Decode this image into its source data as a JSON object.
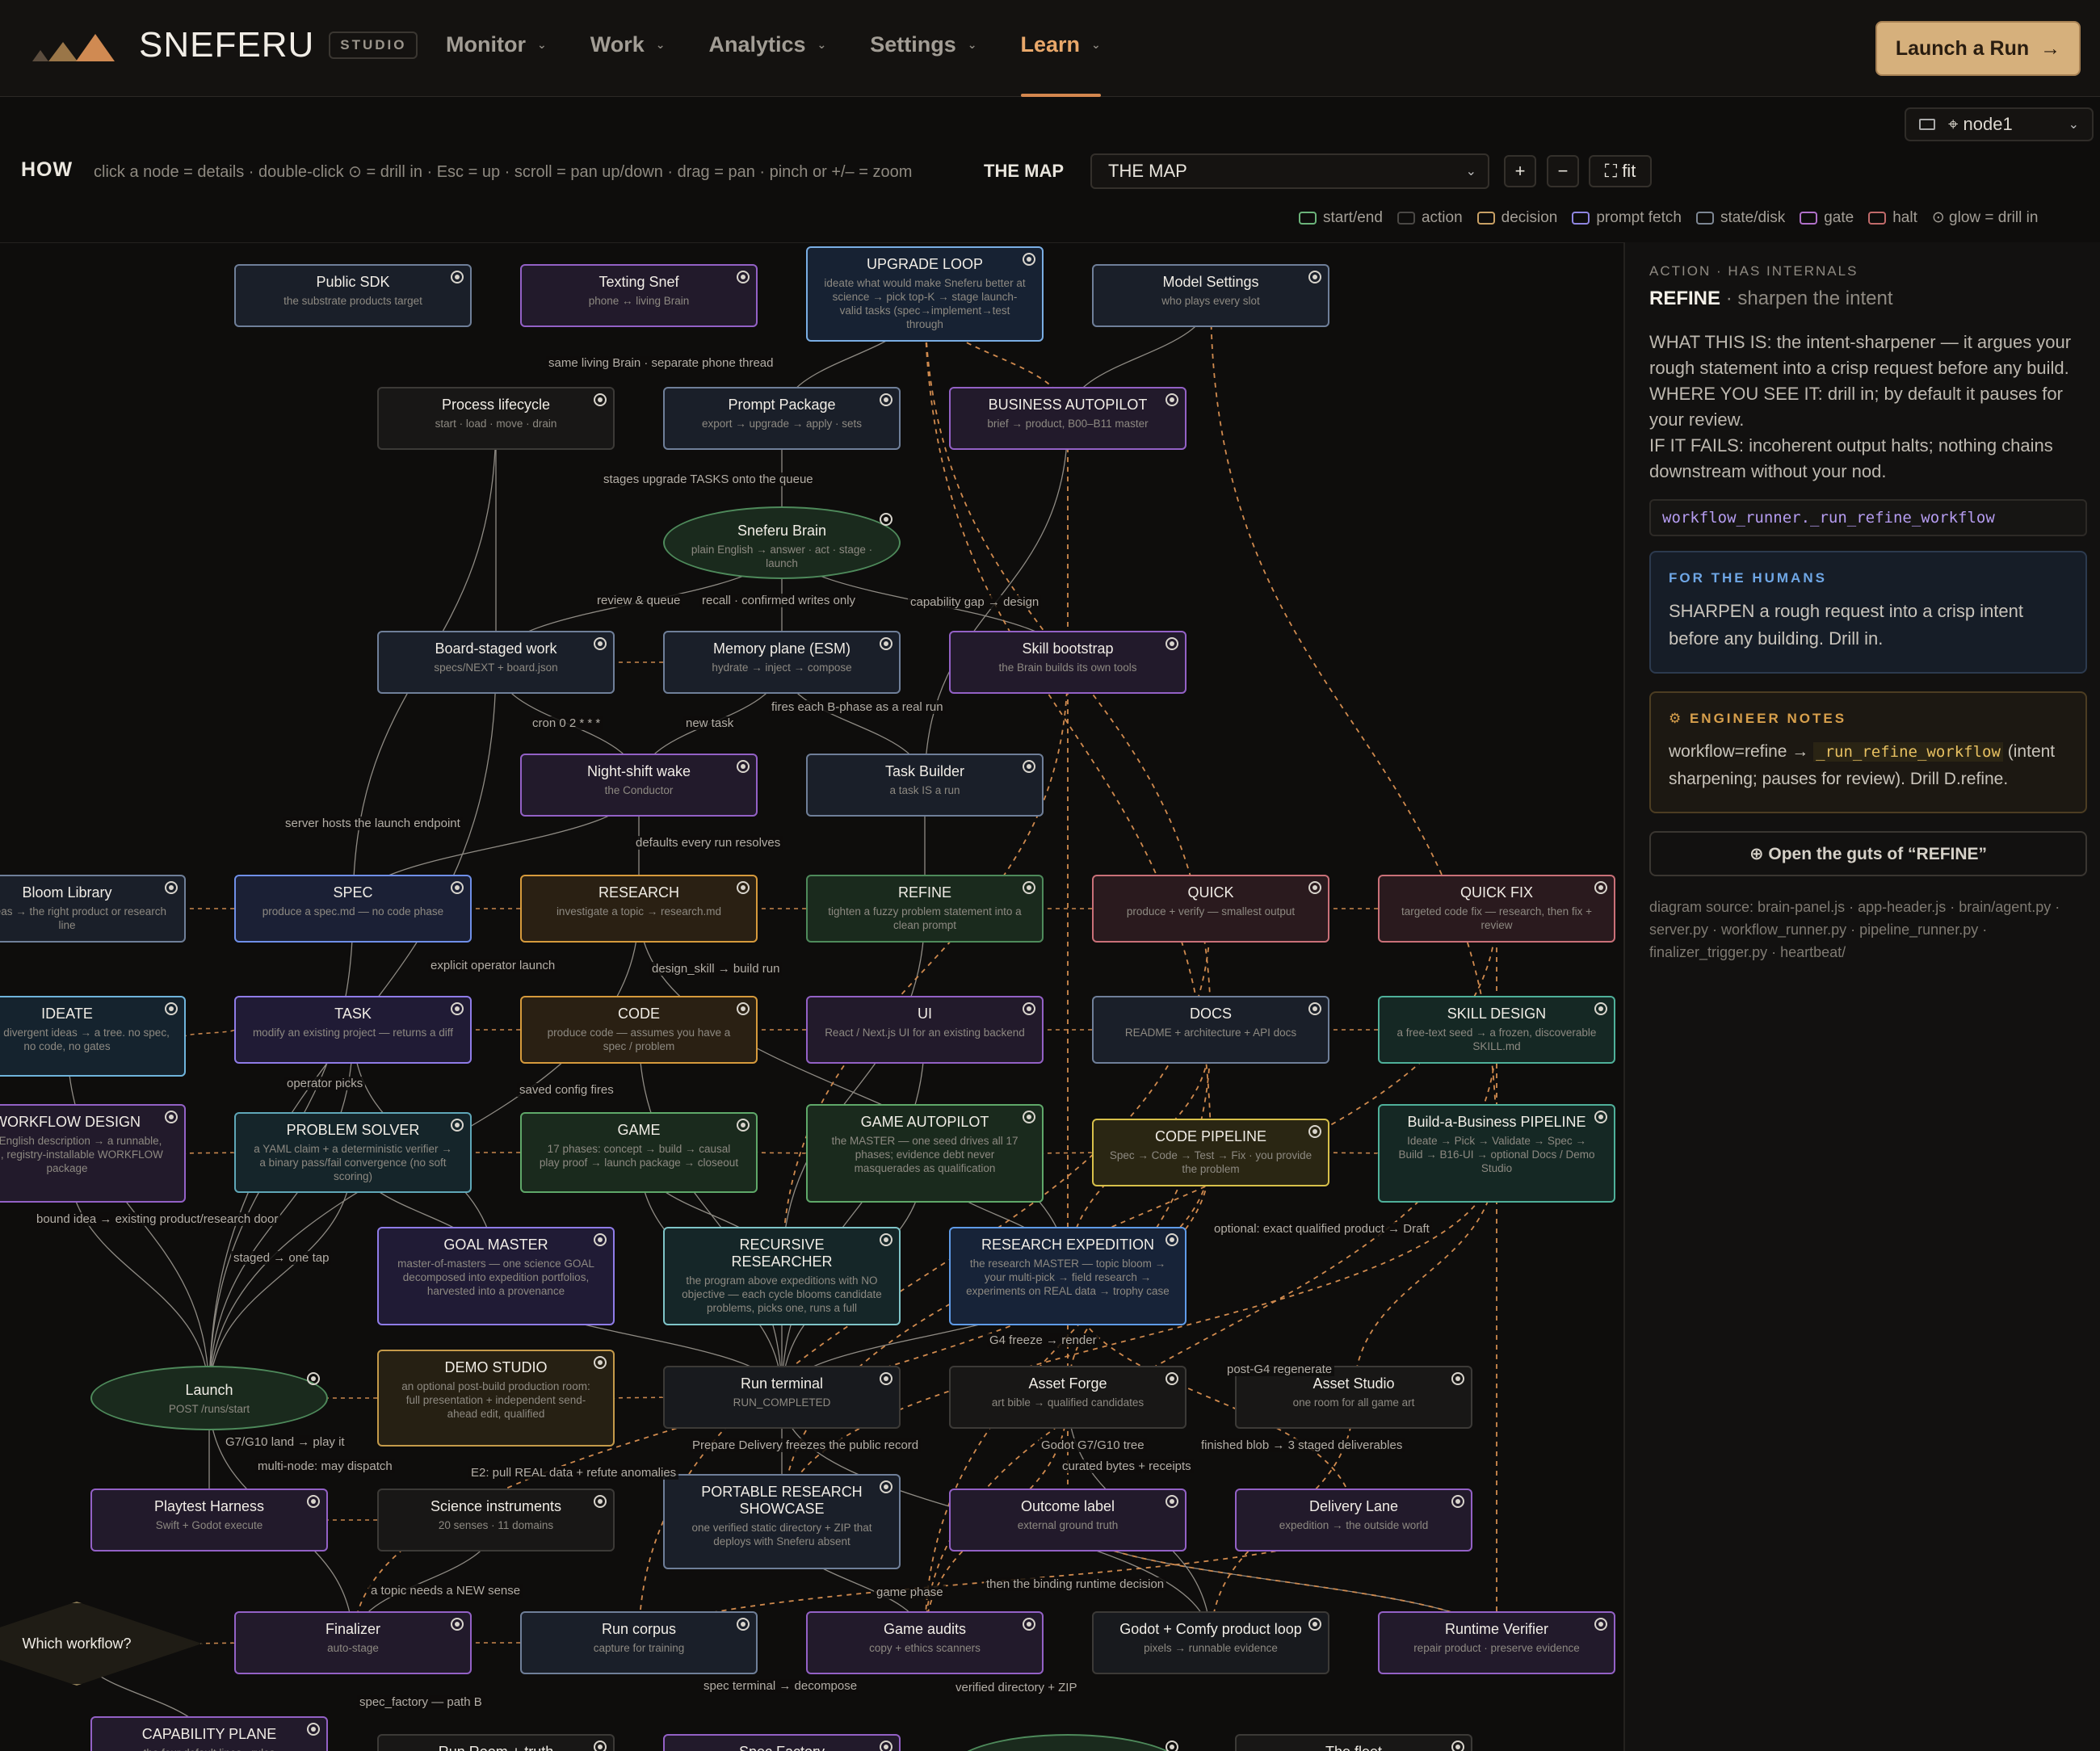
{
  "header": {
    "brand": "SNEFERU",
    "badge": "STUDIO",
    "nav": [
      {
        "label": "Monitor",
        "active": false
      },
      {
        "label": "Work",
        "active": false
      },
      {
        "label": "Analytics",
        "active": false
      },
      {
        "label": "Settings",
        "active": false
      },
      {
        "label": "Learn",
        "active": true
      }
    ],
    "launch_label": "Launch a Run",
    "launch_icon": "arrow-right-icon"
  },
  "toolbar": {
    "node_label": "⌖ node1",
    "how_title": "HOW",
    "how_text": "click a node = details · double-click ⊙ = drill in · Esc = up · scroll = pan up/down · drag = pan · pinch or +/– = zoom",
    "map_label": "THE MAP",
    "map_value": "THE MAP",
    "zoom_in": "+",
    "zoom_out": "−",
    "fit_label": "⛶ fit"
  },
  "legend": [
    {
      "label": "start/end",
      "color": "#6bb37a"
    },
    {
      "label": "action",
      "color": "#4a4845"
    },
    {
      "label": "decision",
      "color": "#c8a064"
    },
    {
      "label": "prompt fetch",
      "color": "#8f85e0"
    },
    {
      "label": "state/disk",
      "color": "#7d8794"
    },
    {
      "label": "gate",
      "color": "#b070c8"
    },
    {
      "label": "halt",
      "color": "#c06a6a"
    },
    {
      "label": "⊙ glow = drill in",
      "color": ""
    }
  ],
  "graph": {
    "nodes": [
      {
        "title": "Public SDK",
        "sub": "the substrate products target",
        "color": "#6f7f99",
        "fill": "#1a1f29"
      },
      {
        "title": "Texting Snef",
        "sub": "phone ↔ living Brain",
        "color": "#9361c6",
        "fill": "#221a2b"
      },
      {
        "title": "UPGRADE LOOP",
        "sub": "ideate what would make Sneferu better at science → pick top-K → stage launch-valid tasks (spec→implement→test through",
        "color": "#7aaee4",
        "fill": "#172233"
      },
      {
        "title": "Model Settings",
        "sub": "who plays every slot",
        "color": "#6f7f99",
        "fill": "#1a1f29"
      },
      {
        "title": "Process lifecycle",
        "sub": "start · load · move · drain",
        "color": "#3c3a37",
        "fill": "#181716"
      },
      {
        "title": "Prompt Package",
        "sub": "export → upgrade → apply · sets",
        "color": "#6f7f99",
        "fill": "#1a1f29"
      },
      {
        "title": "BUSINESS AUTOPILOT",
        "sub": "brief → product, B00–B11 master",
        "color": "#9361c6",
        "fill": "#221a2b"
      },
      {
        "title": "Sneferu Brain",
        "sub": "plain English → answer · act · stage · launch",
        "color": "#4e8a5b",
        "fill": "#1a2a1d"
      },
      {
        "title": "Board-staged work",
        "sub": "specs/NEXT + board.json",
        "color": "#6f7f99",
        "fill": "#1a1f29"
      },
      {
        "title": "Memory plane (ESM)",
        "sub": "hydrate → inject → compose",
        "color": "#6f7f99",
        "fill": "#1a1f29"
      },
      {
        "title": "Skill bootstrap",
        "sub": "the Brain builds its own tools",
        "color": "#9361c6",
        "fill": "#221a2b"
      },
      {
        "title": "Night-shift wake",
        "sub": "the Conductor",
        "color": "#9361c6",
        "fill": "#221a2b"
      },
      {
        "title": "Task Builder",
        "sub": "a task IS a run",
        "color": "#6f7f99",
        "fill": "#1a1f29"
      },
      {
        "title": "Bloom Library",
        "sub": "red ideas → the right product or research line",
        "color": "#6f7f99",
        "fill": "#1a1f29"
      },
      {
        "title": "SPEC",
        "sub": "produce a spec.md — no code phase",
        "color": "#6f8fe8",
        "fill": "#1b2035"
      },
      {
        "title": "RESEARCH",
        "sub": "investigate a topic → research.md",
        "color": "#d69a3c",
        "fill": "#2a2013"
      },
      {
        "title": "REFINE",
        "sub": "tighten a fuzzy problem statement into a clean prompt",
        "color": "#4e8a5b",
        "fill": "#1a2a1d"
      },
      {
        "title": "QUICK",
        "sub": "produce + verify — smallest output",
        "color": "#c97078",
        "fill": "#2a1a1e"
      },
      {
        "title": "QUICK FIX",
        "sub": "targeted code fix — research, then fix + review",
        "color": "#c97078",
        "fill": "#2a1a1e"
      },
      {
        "title": "IDEATE",
        "sub": "explore divergent ideas → a tree. no spec, no code, no gates",
        "color": "#6fb4dc",
        "fill": "#15232e"
      },
      {
        "title": "TASK",
        "sub": "modify an existing project — returns a diff",
        "color": "#8f7ce8",
        "fill": "#201b35"
      },
      {
        "title": "CODE",
        "sub": "produce code — assumes you have a spec / problem",
        "color": "#d69a3c",
        "fill": "#2a2013"
      },
      {
        "title": "UI",
        "sub": "React / Next.js UI for an existing backend",
        "color": "#9361c6",
        "fill": "#221a2b"
      },
      {
        "title": "DOCS",
        "sub": "README + architecture + API docs",
        "color": "#6f7f99",
        "fill": "#1a1f29"
      },
      {
        "title": "SKILL DESIGN",
        "sub": "a free-text seed → a frozen, discoverable SKILL.md",
        "color": "#4fb09a",
        "fill": "#152824"
      },
      {
        "title": "WORKFLOW DESIGN",
        "sub": "plain-English description → a runnable, tested, registry-installable WORKFLOW package",
        "color": "#9361c6",
        "fill": "#221a2b"
      },
      {
        "title": "PROBLEM SOLVER",
        "sub": "a YAML claim + a deterministic verifier → a binary pass/fail convergence (no soft scoring)",
        "color": "#5fa7b8",
        "fill": "#15252a"
      },
      {
        "title": "GAME",
        "sub": "17 phases: concept → build → causal play proof → launch package → closeout",
        "color": "#5fa869",
        "fill": "#1a2a1d"
      },
      {
        "title": "GAME AUTOPILOT",
        "sub": "the MASTER — one seed drives all 17 phases; evidence debt never masquerades as qualification",
        "color": "#5fa869",
        "fill": "#1a2a1d"
      },
      {
        "title": "CODE PIPELINE",
        "sub": "Spec → Code → Test → Fix · you provide the problem",
        "color": "#d7c04a",
        "fill": "#2a2613"
      },
      {
        "title": "Build-a-Business PIPELINE",
        "sub": "Ideate → Pick → Validate → Spec → Build → B16-UI → optional Docs / Demo Studio",
        "color": "#4fb09a",
        "fill": "#152824"
      },
      {
        "title": "GOAL MASTER",
        "sub": "master-of-masters — one science GOAL decomposed into expedition portfolios, harvested into a provenance",
        "color": "#8f7ce8",
        "fill": "#201b35"
      },
      {
        "title": "RECURSIVE RESEARCHER",
        "sub": "the program above expeditions with NO objective — each cycle blooms candidate problems, picks one, runs a full",
        "color": "#7fc4c8",
        "fill": "#152628"
      },
      {
        "title": "RESEARCH EXPEDITION",
        "sub": "the research MASTER — topic bloom → your multi-pick → field research → experiments on REAL data → trophy case",
        "color": "#5f9be8",
        "fill": "#172338"
      },
      {
        "title": "Launch",
        "sub": "POST /runs/start",
        "color": "#4e8a5b",
        "fill": "#1a2a1d"
      },
      {
        "title": "DEMO STUDIO",
        "sub": "an optional post-build production room: full presentation + independent send-ahead edit, qualified",
        "color": "#c49a4a",
        "fill": "#262013"
      },
      {
        "title": "Run terminal",
        "sub": "RUN_COMPLETED",
        "color": "#3c3a37",
        "fill": "#181a1e"
      },
      {
        "title": "Asset Forge",
        "sub": "art bible → qualified candidates",
        "color": "#3c3a37",
        "fill": "#181716"
      },
      {
        "title": "Asset Studio",
        "sub": "one room for all game art",
        "color": "#3c3a37",
        "fill": "#181716"
      },
      {
        "title": "Playtest Harness",
        "sub": "Swift + Godot execute",
        "color": "#9361c6",
        "fill": "#221a2b"
      },
      {
        "title": "Science instruments",
        "sub": "20 senses · 11 domains",
        "color": "#3c3a37",
        "fill": "#181716"
      },
      {
        "title": "PORTABLE RESEARCH SHOWCASE",
        "sub": "one verified static directory + ZIP that deploys with Sneferu absent",
        "color": "#6f7f99",
        "fill": "#1a1f29"
      },
      {
        "title": "Outcome label",
        "sub": "external ground truth",
        "color": "#9361c6",
        "fill": "#221a2b"
      },
      {
        "title": "Delivery Lane",
        "sub": "expedition → the outside world",
        "color": "#9361c6",
        "fill": "#221a2b"
      },
      {
        "title": "Which workflow?",
        "sub": "",
        "color": "#8a7a55",
        "fill": "#1f1c15"
      },
      {
        "title": "Finalizer",
        "sub": "auto-stage",
        "color": "#9361c6",
        "fill": "#221a2b"
      },
      {
        "title": "Run corpus",
        "sub": "capture for training",
        "color": "#6f7f99",
        "fill": "#1a1f29"
      },
      {
        "title": "Game audits",
        "sub": "copy + ethics scanners",
        "color": "#9361c6",
        "fill": "#221a2b"
      },
      {
        "title": "Godot + Comfy product loop",
        "sub": "pixels → runnable evidence",
        "color": "#3c3a37",
        "fill": "#181a1e"
      },
      {
        "title": "Runtime Verifier",
        "sub": "repair product · preserve evidence",
        "color": "#9361c6",
        "fill": "#221a2b"
      },
      {
        "title": "CAPABILITY PLANE",
        "sub": "the four default lines · rules",
        "color": "#9361c6",
        "fill": "#221a2b"
      },
      {
        "title": "Run Room + truth",
        "sub": "",
        "color": "#3c3a37",
        "fill": "#181716"
      },
      {
        "title": "Spec Factory",
        "sub": "",
        "color": "#9361c6",
        "fill": "#221a2b"
      },
      {
        "title": "",
        "sub": "",
        "color": "#4e8a5b",
        "fill": "#1a2a1d"
      },
      {
        "title": "The fleet",
        "sub": "",
        "color": "#3c3a37",
        "fill": "#181716"
      }
    ],
    "edge_labels": [
      "same living Brain · separate phone thread",
      "stages upgrade TASKS onto the queue",
      "review & queue",
      "recall · confirmed writes only",
      "capability gap → design",
      "fires each B-phase as a real run",
      "cron 0 2 * * *",
      "new task",
      "server hosts the launch endpoint",
      "defaults every run resolves",
      "explicit operator launch",
      "design_skill → build run",
      "operator picks",
      "saved config fires",
      "bound idea → existing product/research door",
      "staged → one tap",
      "optional: exact qualified product → Draft",
      "G4 freeze → render",
      "post-G4 regenerate",
      "G7/G10 land → play it",
      "Prepare Delivery freezes the public record",
      "Godot G7/G10 tree",
      "finished blob → 3 staged deliverables",
      "curated bytes + receipts",
      "multi-node: may dispatch",
      "E2: pull REAL data + refute anomalies",
      "a topic needs a NEW sense",
      "game phase",
      "then the binding runtime decision",
      "spec terminal → decompose",
      "verified directory + ZIP",
      "spec_factory — path B"
    ]
  },
  "panel": {
    "kicker": "ACTION · HAS INTERNALS",
    "title": "REFINE",
    "title_sub": "· sharpen the intent",
    "what": "WHAT THIS IS: the intent-sharpener — it argues your rough statement into a crisp request before any build.",
    "where": "WHERE YOU SEE IT: drill in; by default it pauses for your review.",
    "fails": "IF IT FAILS: incoherent output halts; nothing chains downstream without your nod.",
    "code": "workflow_runner._run_refine_workflow",
    "humans_heading": "FOR THE HUMANS",
    "humans_text": "SHARPEN a rough request into a crisp intent before any building. Drill in.",
    "eng_heading": "⚙ ENGINEER NOTES",
    "eng_pre": "workflow=refine → ",
    "eng_code": "_run_refine_workflow",
    "eng_post": " (intent sharpening; pauses for review). Drill D.refine.",
    "open_label": "⊕ Open the guts of “REFINE”",
    "sources": "diagram source: brain-panel.js · app-header.js · brain/agent.py · server.py · workflow_runner.py · pipeline_runner.py · finalizer_trigger.py · heartbeat/"
  }
}
